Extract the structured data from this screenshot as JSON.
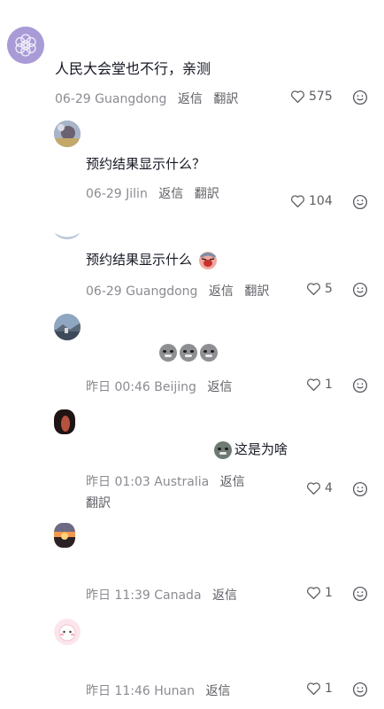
{
  "comments": [
    {
      "text": "人民大会堂也不行，亲测",
      "date": "06-29",
      "location": "Guangdong",
      "reply": "返信",
      "translate": "翻訳",
      "likes": "575"
    },
    {
      "text": "预约结果显示什么？",
      "date": "06-29",
      "location": "Jilin",
      "reply": "返信",
      "translate": "翻訳",
      "likes": "104"
    },
    {
      "text": "预约结果显示什么",
      "date": "06-29",
      "location": "Guangdong",
      "reply": "返信",
      "translate": "翻訳",
      "likes": "5"
    },
    {
      "date": "昨日 00:46",
      "location": "Beijing",
      "reply": "返信",
      "likes": "1"
    },
    {
      "text": "这是为啥",
      "date": "昨日 01:03",
      "location": "Australia",
      "reply": "返信",
      "translate": "翻訳",
      "likes": "4"
    },
    {
      "date": "昨日 11:39",
      "location": "Canada",
      "reply": "返信",
      "likes": "1"
    },
    {
      "date": "昨日 11:46",
      "location": "Hunan",
      "reply": "返信",
      "likes": "1"
    }
  ],
  "icons": {
    "like": "heart-outline-icon",
    "react": "smiley-face-icon"
  },
  "colors": {
    "meta": "#8a8b91",
    "action": "#5c5d63",
    "text": "#161823"
  }
}
